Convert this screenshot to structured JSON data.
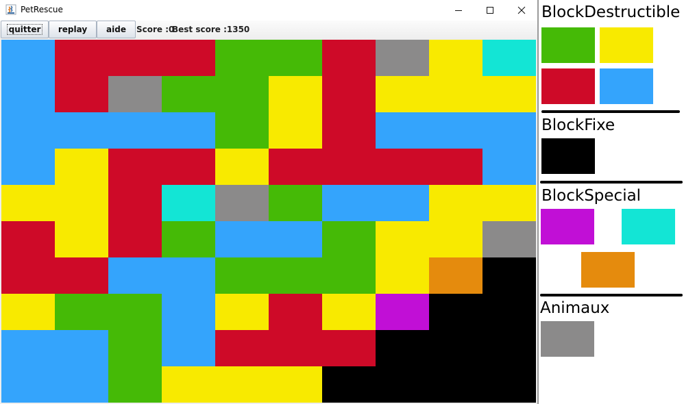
{
  "window": {
    "title": "PetRescue",
    "controls": [
      "minimize-icon",
      "maximize-icon",
      "close-icon"
    ]
  },
  "toolbar": {
    "quit_label": "quitter",
    "replay_label": "replay",
    "help_label": "aide",
    "score_text": "Score :0",
    "best_score_text": "Best score :1350"
  },
  "colors": {
    "B": "#34a4fc",
    "R": "#ce0a28",
    "G": "#45ba06",
    "Y": "#f8ea00",
    "S": "#8b8a8a",
    "C": "#13e5d5",
    "M": "#c10fd6",
    "O": "#e58b0d",
    "K": "#000000"
  },
  "board": {
    "rows": [
      "BRRRGGRSYC",
      "BRSGGYRYYY",
      "BBBBGYRBBB",
      "BYRRYRRRRB",
      "YYRCSGBBYY",
      "RYRGBBGYYS",
      "RRBBGGGYOK",
      "YGGBYRYMKK",
      "BBGBRRRKKK",
      "BBGYYYKKKK"
    ]
  },
  "legend": {
    "sections": [
      {
        "title": "BlockDestructible",
        "swatches": [
          "G",
          "Y",
          "R",
          "B"
        ]
      },
      {
        "title": "BlockFixe",
        "swatches": [
          "K"
        ]
      },
      {
        "title": "BlockSpecial",
        "swatches": [
          "M",
          "C",
          "O"
        ]
      },
      {
        "title": "Animaux",
        "swatches": [
          "S"
        ]
      }
    ]
  }
}
